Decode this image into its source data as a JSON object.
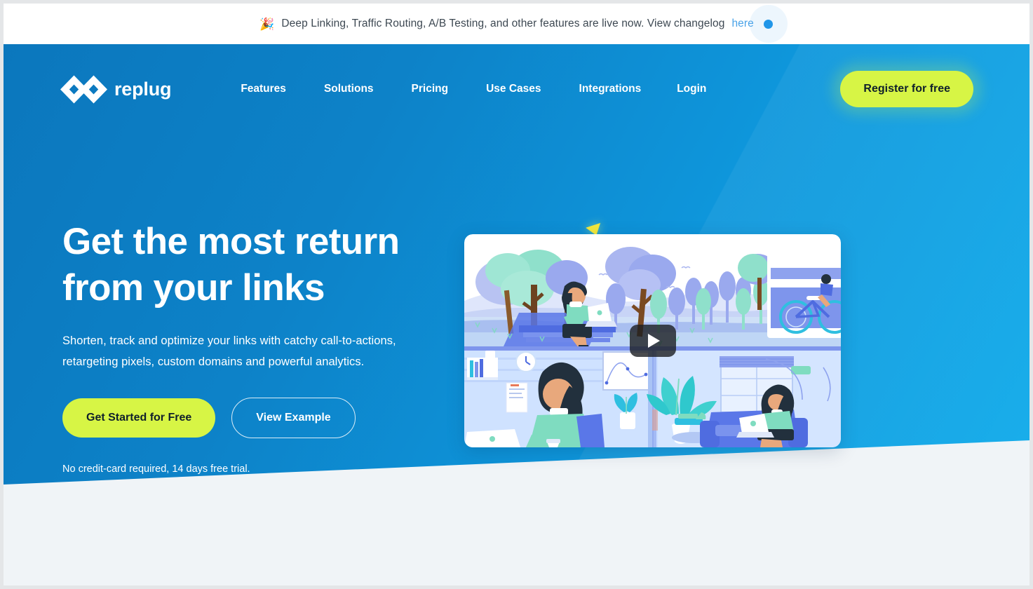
{
  "announcement": {
    "icon": "party-popper-icon",
    "text": "Deep Linking, Traffic Routing, A/B Testing, and other features are live now. View changelog",
    "link_label": "here",
    "link_color": "#4aa3e8",
    "dot_color": "#2196e8"
  },
  "nav": {
    "brand_name": "replug",
    "logo_icon": "replug-double-diamond-logo",
    "links": [
      {
        "label": "Features"
      },
      {
        "label": "Solutions"
      },
      {
        "label": "Pricing"
      },
      {
        "label": "Use Cases"
      },
      {
        "label": "Integrations"
      },
      {
        "label": "Login"
      }
    ],
    "register_label": "Register for free",
    "register_bg": "#d7f545"
  },
  "hero": {
    "title": "Get the most return\nfrom your links",
    "subtitle": "Shorten, track and optimize your links with catchy call-to-actions,\nretargeting pixels, custom domains and powerful analytics.",
    "primary_cta": "Get Started for Free",
    "secondary_cta": "View Example",
    "note": "No credit-card required, 14 days free trial.",
    "background_color": "#0d82c8",
    "accent_color": "#d7f545"
  },
  "video": {
    "name": "hero-video-thumbnail",
    "play_icon": "play-triangle-icon",
    "alt": "Illustration of people working remotely on laptops outdoors and at home"
  }
}
